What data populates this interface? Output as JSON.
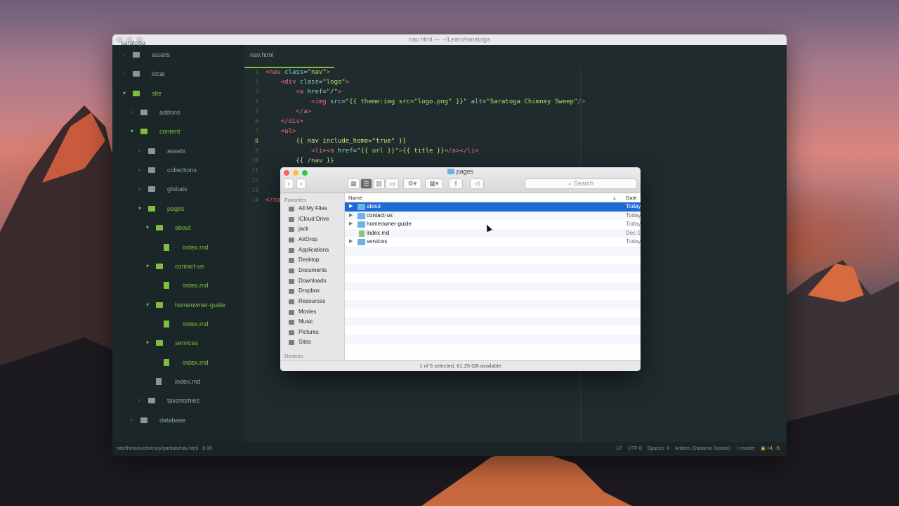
{
  "editor": {
    "window_title": "nav.html — ~/Learn/saratoga",
    "tree_root": "saratoga",
    "tab": "nav.html",
    "status_path": "site/themes/chimney/partials/nav.html",
    "status_pos": "8:36",
    "status_right": [
      "LF",
      "UTF-8",
      "Spaces: 4",
      "Antlers (Statamic Syntax)",
      "master"
    ],
    "git_diff": "+4, -5",
    "tree": [
      {
        "label": "assets",
        "open": false,
        "kind": "folder"
      },
      {
        "label": "local",
        "open": false,
        "kind": "folder"
      },
      {
        "label": "site",
        "open": true,
        "kind": "folder"
      },
      {
        "label": "addons",
        "open": false,
        "kind": "folder"
      },
      {
        "label": "content",
        "open": true,
        "kind": "folder"
      },
      {
        "label": "assets",
        "open": false,
        "kind": "folder"
      },
      {
        "label": "collections",
        "open": false,
        "kind": "folder"
      },
      {
        "label": "globals",
        "open": false,
        "kind": "folder"
      },
      {
        "label": "pages",
        "open": true,
        "kind": "folder"
      },
      {
        "label": "about",
        "open": true,
        "kind": "folder"
      },
      {
        "label": "index.md",
        "kind": "file"
      },
      {
        "label": "contact-us",
        "open": true,
        "kind": "folder"
      },
      {
        "label": "index.md",
        "kind": "file"
      },
      {
        "label": "homeowner-guide",
        "open": true,
        "kind": "folder"
      },
      {
        "label": "index.md",
        "kind": "file"
      },
      {
        "label": "services",
        "open": true,
        "kind": "folder"
      },
      {
        "label": "index.md",
        "kind": "file"
      },
      {
        "label": "index.md",
        "kind": "file"
      },
      {
        "label": "taxonomies",
        "open": false,
        "kind": "folder"
      },
      {
        "label": "database",
        "open": false,
        "kind": "folder"
      }
    ],
    "line_numbers": [
      "1",
      "2",
      "3",
      "4",
      "5",
      "6",
      "7",
      "8",
      "9",
      "10",
      "11",
      "12",
      "13",
      "14"
    ],
    "active_line": "8"
  },
  "finder": {
    "title": "pages",
    "search_placeholder": "Search",
    "col_name": "Name",
    "col_date": "Date M",
    "favorites_label": "Favorites",
    "devices_label": "Devices",
    "sidebar": [
      "All My Files",
      "iCloud Drive",
      "jack",
      "AirDrop",
      "Applications",
      "Desktop",
      "Documents",
      "Downloads",
      "Dropbox",
      "Resources",
      "Movies",
      "Music",
      "Pictures",
      "Sites"
    ],
    "rows": [
      {
        "name": "about",
        "date": "Today",
        "folder": true,
        "selected": true
      },
      {
        "name": "contact-us",
        "date": "Today",
        "folder": true,
        "selected": false
      },
      {
        "name": "homeowner-guide",
        "date": "Today",
        "folder": true,
        "selected": false
      },
      {
        "name": "index.md",
        "date": "Dec 1",
        "folder": false,
        "selected": false
      },
      {
        "name": "services",
        "date": "Today",
        "folder": true,
        "selected": false
      }
    ],
    "status": "1 of 5 selected, 61.25 GB available"
  }
}
